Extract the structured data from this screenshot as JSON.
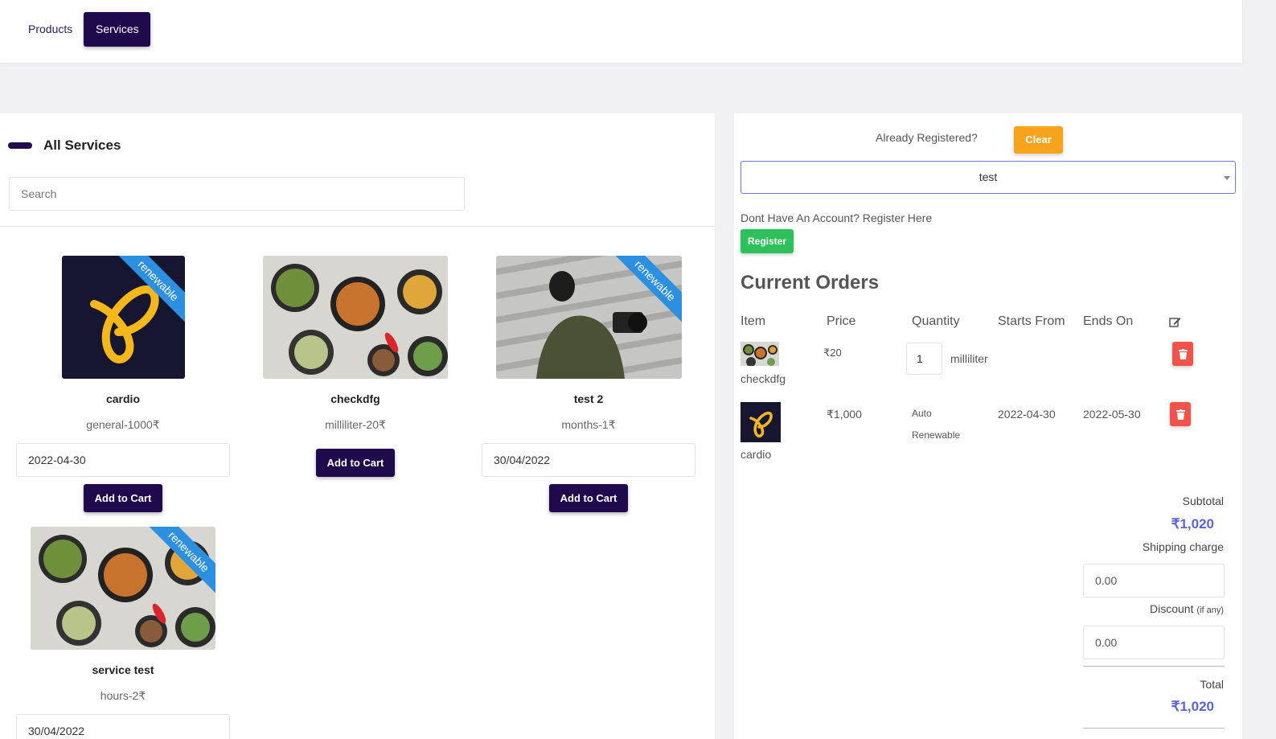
{
  "nav": {
    "products_label": "Products",
    "services_label": "Services"
  },
  "services": {
    "section_title": "All Services",
    "search_placeholder": "Search",
    "ribbon_label": "renewable",
    "items": [
      {
        "name": "cardio",
        "sub": "general-1000₹",
        "date": "2022-04-30",
        "button": "Add to Cart",
        "image": "logo",
        "renewable": true
      },
      {
        "name": "checkdfg",
        "sub": "milliliter-20₹",
        "date": "",
        "button": "Add to Cart",
        "image": "food",
        "renewable": false
      },
      {
        "name": "test 2",
        "sub": "months-1₹",
        "date": "30/04/2022",
        "button": "Add to Cart",
        "image": "photographer",
        "renewable": true
      },
      {
        "name": "service test",
        "sub": "hours-2₹",
        "date": "30/04/2022",
        "button": "Add to Cart",
        "image": "food",
        "renewable": true
      }
    ]
  },
  "customer": {
    "already_registered": "Already Registered?",
    "clear_label": "Clear",
    "selected_customer": "test",
    "no_account_text": "Dont Have An Account? Register Here",
    "register_label": "Register"
  },
  "orders": {
    "title": "Current Orders",
    "headers": {
      "item": "Item",
      "price": "Price",
      "quantity": "Quantity",
      "starts": "Starts From",
      "ends": "Ends On",
      "edit_icon": "edit-icon"
    },
    "rows": [
      {
        "name": "checkdfg",
        "price": "₹20",
        "quantity": "1",
        "unit": "milliliter",
        "starts": "",
        "ends": ""
      },
      {
        "name": "cardio",
        "price": "₹1,000",
        "quantity_line1": "Auto",
        "quantity_line2": "Renewable",
        "starts": "2022-04-30",
        "ends": "2022-05-30"
      }
    ]
  },
  "summary": {
    "subtotal_label": "Subtotal",
    "subtotal_value": "₹1,020",
    "shipping_label": "Shipping charge",
    "shipping_value": "0.00",
    "discount_label": "Discount",
    "discount_note": "(if any)",
    "discount_value": "0.00",
    "total_label": "Total",
    "total_value": "₹1,020"
  },
  "colors": {
    "primary": "#1f0a4d",
    "ribbon": "#2d8fe0",
    "clear": "#f7a31b",
    "register": "#2ec05a",
    "delete": "#f1524a",
    "amount": "#5a64d8"
  }
}
